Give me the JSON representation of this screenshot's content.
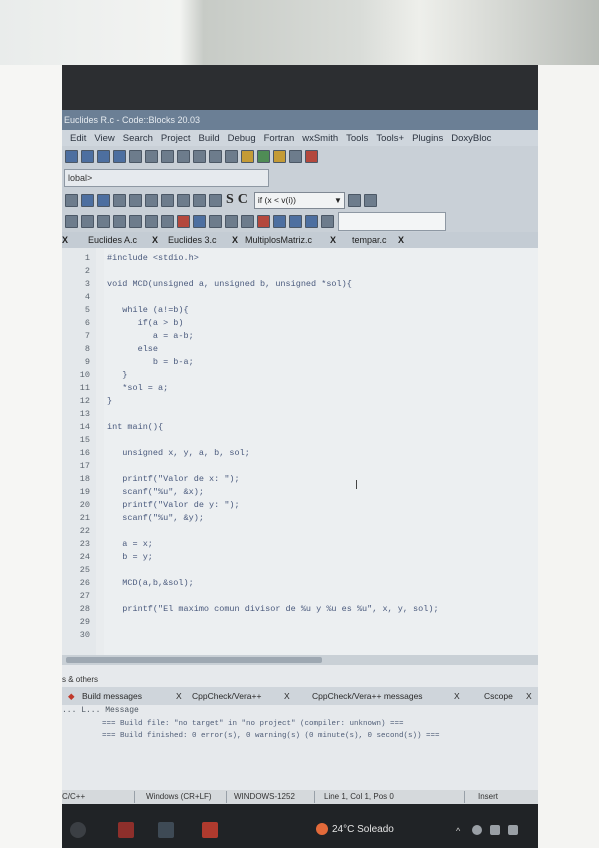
{
  "window": {
    "title": "Euclides R.c - Code::Blocks 20.03"
  },
  "menu": [
    "Edit",
    "View",
    "Search",
    "Project",
    "Build",
    "Debug",
    "Fortran",
    "wxSmith",
    "Tools",
    "Tools+",
    "Plugins",
    "DoxyBloc"
  ],
  "scope": {
    "value": "lobal>"
  },
  "jump_combo": {
    "value": "if (x < v(i))"
  },
  "letters": {
    "s": "S",
    "c": "C"
  },
  "tabs": [
    {
      "label": "Euclides A.c",
      "close": "X"
    },
    {
      "label": "Euclides 3.c",
      "close": "X"
    },
    {
      "label": "MultiplosMatriz.c",
      "close": "X"
    },
    {
      "label": "tempar.c",
      "close": "X"
    }
  ],
  "code_lines": [
    {
      "n": "1",
      "text": "#include <stdio.h>"
    },
    {
      "n": "2",
      "text": ""
    },
    {
      "n": "3",
      "text": "void MCD(unsigned a, unsigned b, unsigned *sol){"
    },
    {
      "n": "4",
      "text": ""
    },
    {
      "n": "5",
      "text": "   while (a!=b){"
    },
    {
      "n": "6",
      "text": "      if(a > b)"
    },
    {
      "n": "7",
      "text": "         a = a-b;"
    },
    {
      "n": "8",
      "text": "      else"
    },
    {
      "n": "9",
      "text": "         b = b-a;"
    },
    {
      "n": "10",
      "text": "   }"
    },
    {
      "n": "11",
      "text": "   *sol = a;"
    },
    {
      "n": "12",
      "text": "}"
    },
    {
      "n": "13",
      "text": ""
    },
    {
      "n": "14",
      "text": "int main(){"
    },
    {
      "n": "15",
      "text": ""
    },
    {
      "n": "16",
      "text": "   unsigned x, y, a, b, sol;"
    },
    {
      "n": "17",
      "text": ""
    },
    {
      "n": "18",
      "text": "   printf(\"Valor de x: \");"
    },
    {
      "n": "19",
      "text": "   scanf(\"%u\", &x);"
    },
    {
      "n": "20",
      "text": "   printf(\"Valor de y: \");"
    },
    {
      "n": "21",
      "text": "   scanf(\"%u\", &y);"
    },
    {
      "n": "22",
      "text": ""
    },
    {
      "n": "23",
      "text": "   a = x;"
    },
    {
      "n": "24",
      "text": "   b = y;"
    },
    {
      "n": "25",
      "text": ""
    },
    {
      "n": "26",
      "text": "   MCD(a,b,&sol);"
    },
    {
      "n": "27",
      "text": ""
    },
    {
      "n": "28",
      "text": "   printf(\"El maximo comun divisor de %u y %u es %u\", x, y, sol);"
    },
    {
      "n": "29",
      "text": ""
    },
    {
      "n": "30",
      "text": ""
    }
  ],
  "logs": {
    "title": "s & others",
    "tabs": [
      {
        "label": "Build messages",
        "close": "X"
      },
      {
        "label": "CppCheck/Vera++",
        "close": "X"
      },
      {
        "label": "CppCheck/Vera++ messages",
        "close": "X"
      },
      {
        "label": "Cscope",
        "close": "X"
      }
    ],
    "header": "... L... Message",
    "messages": [
      "=== Build file: \"no target\" in \"no project\" (compiler: unknown) ===",
      "=== Build finished: 0 error(s), 0 warning(s) (0 minute(s), 0 second(s)) ==="
    ]
  },
  "status": {
    "lang": "C/C++",
    "eol": "Windows (CR+LF)",
    "encoding": "WINDOWS-1252",
    "position": "Line 1, Col 1, Pos 0",
    "mode": "Insert"
  },
  "taskbar": {
    "weather": "24°C Soleado",
    "tray_up": "^"
  }
}
